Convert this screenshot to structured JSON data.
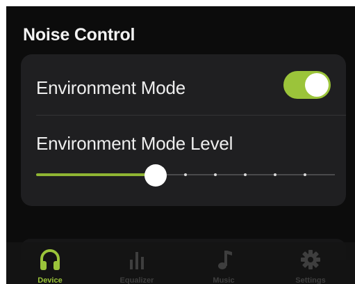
{
  "section_title": "Noise Control",
  "environment_mode": {
    "label": "Environment Mode",
    "enabled": true
  },
  "environment_level": {
    "label": "Environment Mode Level",
    "value": 0.4,
    "steps": 10
  },
  "tabs": [
    {
      "label": "Device",
      "icon": "headphones-icon",
      "active": true
    },
    {
      "label": "Equalizer",
      "icon": "equalizer-icon",
      "active": false
    },
    {
      "label": "Music",
      "icon": "music-note-icon",
      "active": false
    },
    {
      "label": "Settings",
      "icon": "gear-icon",
      "active": false
    }
  ],
  "colors": {
    "accent": "#9bc43a",
    "background": "#0c0c0c",
    "card": "#1f1f21"
  }
}
